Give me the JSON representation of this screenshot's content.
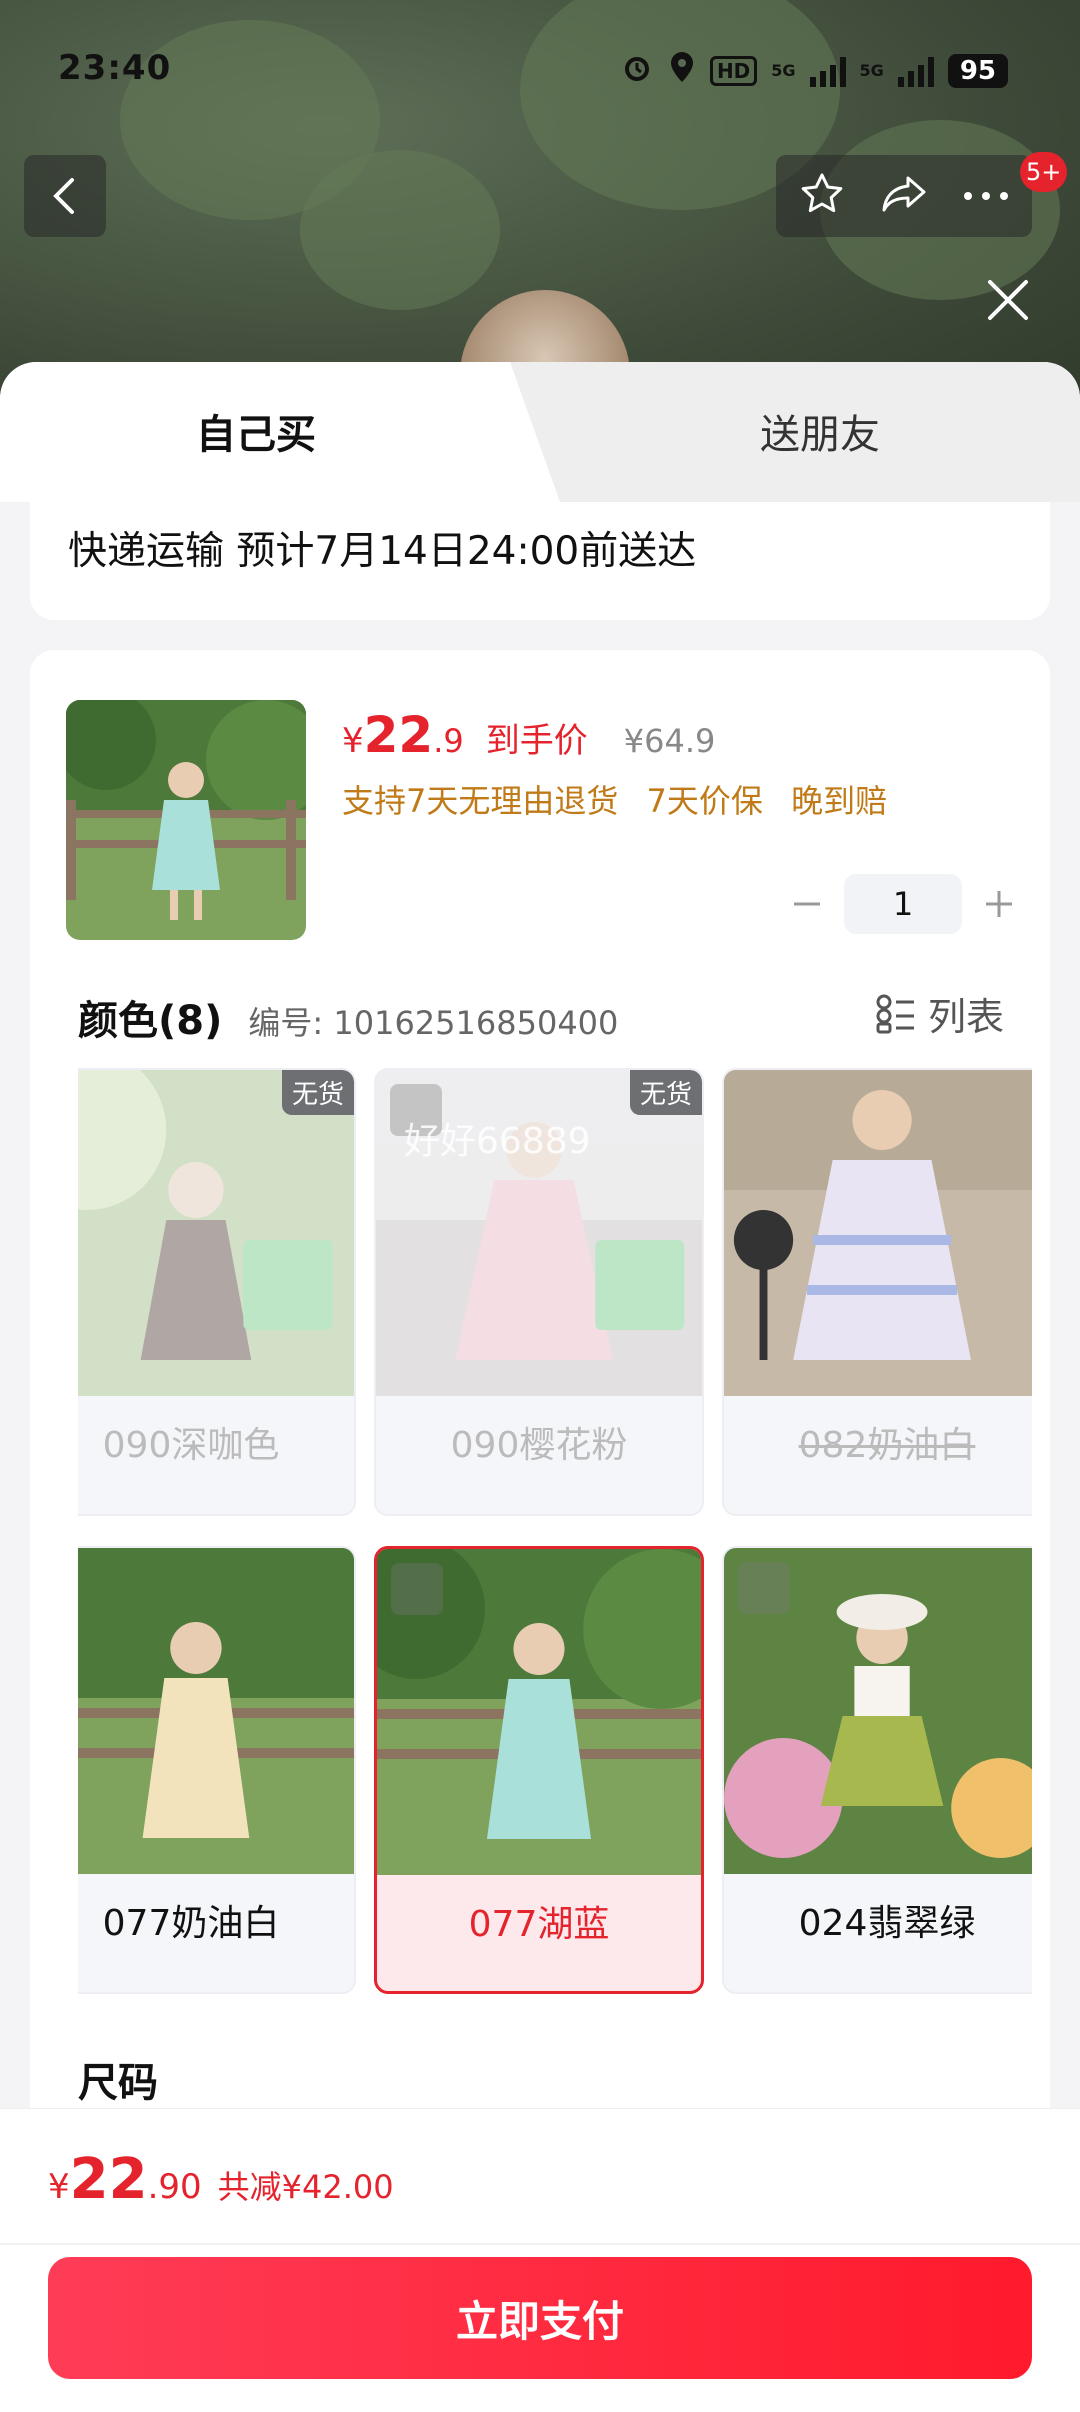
{
  "status_bar": {
    "time": "23:40",
    "battery": "95",
    "network_1": "5G",
    "network_2": "5G",
    "hd": "HD"
  },
  "nav": {
    "cart_badge": "5+"
  },
  "tabs": [
    {
      "label": "自己买",
      "active": true
    },
    {
      "label": "送朋友",
      "active": false
    }
  ],
  "shipping": {
    "text": "快递运输 预计7月14日24:00前送达"
  },
  "product": {
    "price_currency": "¥",
    "price_int": "22",
    "price_dec": ".9",
    "price_label": "到手价",
    "original_price": "¥64.9",
    "promises": [
      "支持7天无理由退货",
      "7天价保",
      "晚到赔"
    ],
    "quantity": "1"
  },
  "color_section": {
    "title": "颜色(8)",
    "code": "编号: 10162516850400",
    "view_toggle": "列表",
    "options": [
      {
        "label": "090深咖色",
        "sold_out": true,
        "sold_out_tag": "无货",
        "strike": false,
        "selected": false
      },
      {
        "label": "090樱花粉",
        "sold_out": true,
        "sold_out_tag": "无货",
        "strike": false,
        "selected": false,
        "watermark": "好好66889"
      },
      {
        "label": "082奶油白",
        "sold_out": true,
        "strike": true,
        "selected": false
      },
      {
        "label": "077奶油白",
        "sold_out": false,
        "selected": false
      },
      {
        "label": "077湖蓝",
        "sold_out": false,
        "selected": true
      },
      {
        "label": "024翡翠绿",
        "sold_out": false,
        "selected": false
      }
    ]
  },
  "size_section": {
    "title": "尺码"
  },
  "footer": {
    "currency": "¥",
    "total_int": "22",
    "total_dec": ".90",
    "savings": "共减¥42.00",
    "pay_button": "立即支付"
  },
  "colors": {
    "accent": "#e5232d",
    "promise": "#c07a17"
  }
}
